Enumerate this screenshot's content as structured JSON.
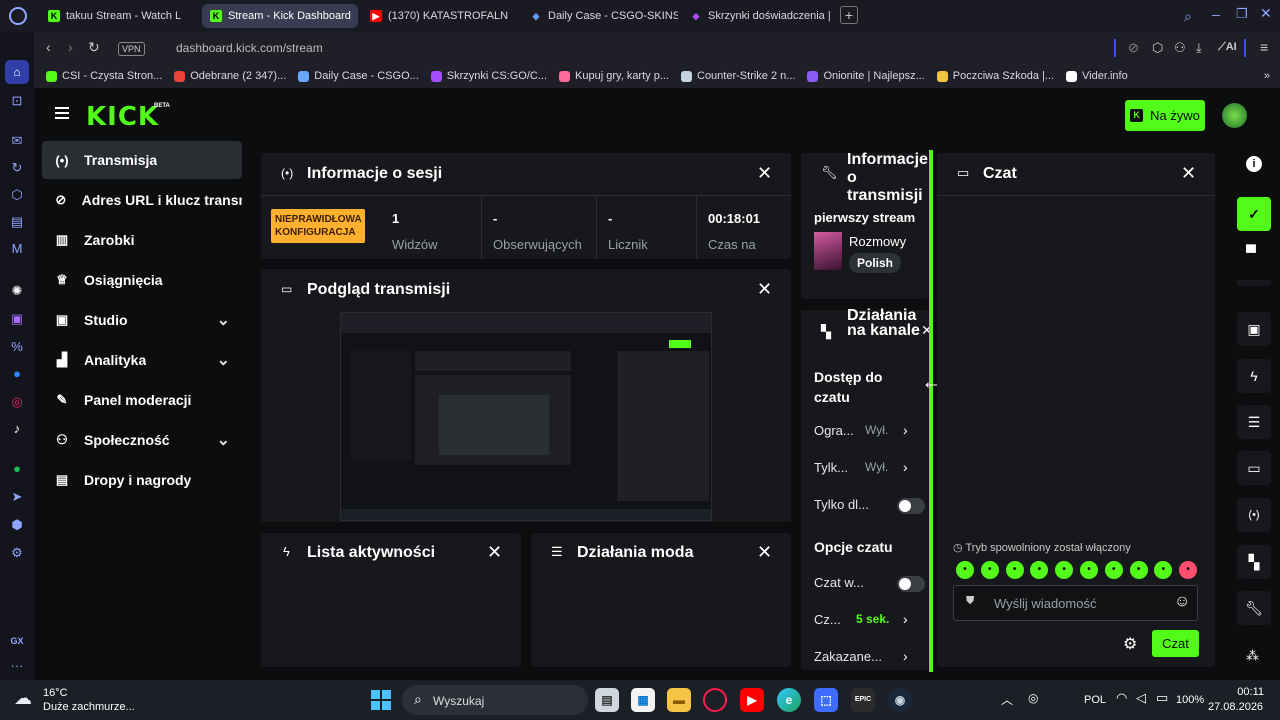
{
  "browser": {
    "tabs": [
      {
        "label": "takuu Stream - Watch L",
        "icon": "kick-favicon",
        "color": "#53fc18"
      },
      {
        "label": "Stream - Kick Dashboard",
        "icon": "kick-favicon",
        "color": "#53fc18"
      },
      {
        "label": "(1370) KATASTROFALN",
        "icon": "youtube-favicon",
        "color": "#ff0000"
      },
      {
        "label": "Daily Case - CSGO-SKINS",
        "icon": "dailycase-favicon",
        "color": "#6aa6ff"
      },
      {
        "label": "Skrzynki doświadczenia | C",
        "icon": "skrzynki-favicon",
        "color": "#a64dff"
      }
    ],
    "url": "dashboard.kick.com/stream",
    "vpn": "VPN",
    "ai": "AI",
    "bookmarks": [
      {
        "label": "CSI - Czysta Stron...",
        "color": "#53fc18"
      },
      {
        "label": "Odebrane (2 347)...",
        "color": "#ea4335"
      },
      {
        "label": "Daily Case - CSGO...",
        "color": "#6aa6ff"
      },
      {
        "label": "Skrzynki CS:GO/C...",
        "color": "#a64dff"
      },
      {
        "label": "Kupuj gry, karty p...",
        "color": "#ff6a9a"
      },
      {
        "label": "Counter-Strike 2 n...",
        "color": "#c7d5e0"
      },
      {
        "label": "Onionite | Najlepsz...",
        "color": "#8a5cf6"
      },
      {
        "label": "Poczciwa Szkoda |...",
        "color": "#f5c542"
      },
      {
        "label": "Vider.info",
        "color": "#ffffff"
      }
    ]
  },
  "kick": {
    "logo": "KICK",
    "beta": "BETA",
    "live_button": "Na żywo",
    "nav": [
      {
        "label": "Transmisja",
        "icon": "stream-icon",
        "active": true,
        "chevron": false
      },
      {
        "label": "Adres URL i klucz transmisji",
        "icon": "link-icon",
        "active": false,
        "chevron": false
      },
      {
        "label": "Zarobki",
        "icon": "chart-icon",
        "active": false,
        "chevron": false
      },
      {
        "label": "Osiągnięcia",
        "icon": "trophy-icon",
        "active": false,
        "chevron": false
      },
      {
        "label": "Studio",
        "icon": "studio-icon",
        "active": false,
        "chevron": true
      },
      {
        "label": "Analityka",
        "icon": "analytics-icon",
        "active": false,
        "chevron": true
      },
      {
        "label": "Panel moderacji",
        "icon": "wrench-icon",
        "active": false,
        "chevron": false
      },
      {
        "label": "Społeczność",
        "icon": "community-icon",
        "active": false,
        "chevron": true
      },
      {
        "label": "Dropy i nagrody",
        "icon": "gift-icon",
        "active": false,
        "chevron": false
      }
    ],
    "session": {
      "title": "Informacje o sesji",
      "badge": "NIEPRAWIDŁOWA KONFIGURACJA",
      "stats": [
        {
          "value": "1",
          "label": "Widzów"
        },
        {
          "value": "-",
          "label": "Obserwujących"
        },
        {
          "value": "-",
          "label": "Licznik"
        },
        {
          "value": "00:18:01",
          "label": "Czas na"
        }
      ]
    },
    "preview": {
      "title": "Podgląd transmisji"
    },
    "activity": {
      "title": "Lista aktywności"
    },
    "modactions": {
      "title": "Działania moda"
    },
    "streaminfo": {
      "title": "Informacje o transmisji",
      "stream_title": "pierwszy stream",
      "category": "Rozmowy",
      "language": "Polish"
    },
    "channel": {
      "title": "Działania na kanale",
      "access_title": "Dostęp do czatu",
      "access_rows": [
        {
          "label": "Ogra...",
          "value": "Wył."
        },
        {
          "label": "Tylk...",
          "value": "Wył."
        },
        {
          "label": "Tylko dl...",
          "value": ""
        }
      ],
      "options_title": "Opcje czatu",
      "option_rows": [
        {
          "label": "Czat w...",
          "value": ""
        },
        {
          "label": "Cz...",
          "value": "5 sek."
        },
        {
          "label": "Zakazane...",
          "value": ""
        }
      ]
    },
    "chat": {
      "title": "Czat",
      "slowmode_notice": "Tryb spowolniony został włączony",
      "placeholder": "Wyślij wiadomość",
      "send": "Czat"
    }
  },
  "taskbar": {
    "weather_temp": "16°C",
    "weather_desc": "Duże zachmurze...",
    "search": "Wyszukaj",
    "lang": "POL",
    "battery": "100%",
    "time": "00:11",
    "date": "27.08.2026"
  }
}
